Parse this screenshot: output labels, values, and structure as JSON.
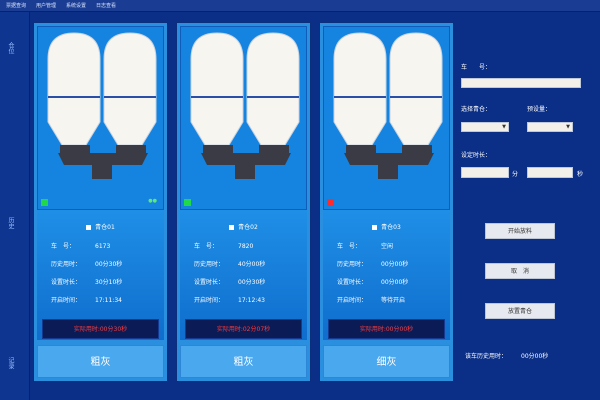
{
  "menu": [
    "票据查询",
    "用户管理",
    "系统设置",
    "日志查看"
  ],
  "left_nav": [
    "仓位",
    "历史",
    "记录"
  ],
  "panels": [
    {
      "id": "silo-01",
      "status_color": "#20d84a",
      "silo_label": "青仓01",
      "rows": [
        {
          "label": "车　号：",
          "value": "6173"
        },
        {
          "label": "历史用时：",
          "value": "00分30秒"
        },
        {
          "label": "设置时长：",
          "value": "30分10秒"
        },
        {
          "label": "开启时间：",
          "value": "17:11:34"
        }
      ],
      "alert": "实际用时:00分30秒",
      "material": "粗灰"
    },
    {
      "id": "silo-02",
      "status_color": "#20d84a",
      "silo_label": "青仓02",
      "rows": [
        {
          "label": "车　号：",
          "value": "7820"
        },
        {
          "label": "历史用时：",
          "value": "40分00秒"
        },
        {
          "label": "设置时长：",
          "value": "00分30秒"
        },
        {
          "label": "开启时间：",
          "value": "17:12:43"
        }
      ],
      "alert": "实际用时:02分07秒",
      "material": "粗灰"
    },
    {
      "id": "silo-03",
      "status_color": "#ff2a2a",
      "silo_label": "青仓03",
      "rows": [
        {
          "label": "车　号：",
          "value": "空闲"
        },
        {
          "label": "历史用时：",
          "value": "00分00秒"
        },
        {
          "label": "设置时长：",
          "value": "00分00秒"
        },
        {
          "label": "开启时间：",
          "value": "等待开启"
        }
      ],
      "alert": "实际用时:00分00秒",
      "material": "细灰"
    }
  ],
  "side": {
    "car_label": "车　　号：",
    "select_silo_label": "选择青仓：",
    "preset_label": "预设量：",
    "set_time_label": "设定时长：",
    "min_unit": "分",
    "sec_unit": "秒",
    "buttons": [
      "开始放料",
      "取　消",
      "放置青仓"
    ],
    "history_label": "该车历史用时：",
    "history_value": "00分00秒"
  }
}
